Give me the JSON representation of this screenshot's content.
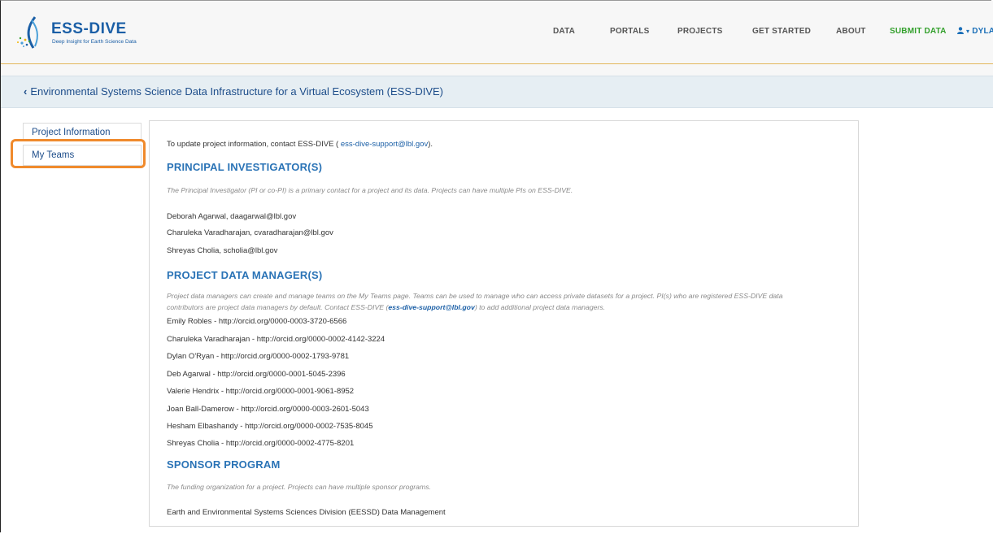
{
  "header": {
    "logo_title": "ESS-DIVE",
    "logo_tagline": "Deep Insight for Earth Science Data",
    "nav": [
      {
        "label": "DATA"
      },
      {
        "label": "PORTALS"
      },
      {
        "label": "PROJECTS"
      },
      {
        "label": "GET STARTED"
      },
      {
        "label": "ABOUT"
      },
      {
        "label": "SUBMIT DATA"
      },
      {
        "label": "DYLAN P."
      }
    ],
    "user_icon": "user-icon",
    "accent_color": "#33a02c",
    "brand_color": "#1b5fa6"
  },
  "breadcrumb": {
    "chevron": "‹",
    "label": "Environmental Systems Science Data Infrastructure for a Virtual Ecosystem (ESS-DIVE)"
  },
  "sidebar": {
    "items": [
      {
        "label": "Project Information"
      },
      {
        "label": "My Teams"
      }
    ],
    "highlight_color": "#f08a2c"
  },
  "main": {
    "intro": {
      "before": "To update project information, contact ESS-DIVE (",
      "link": " ess-dive-support@lbl.gov",
      "after": ")."
    },
    "pi": {
      "heading": "PRINCIPAL INVESTIGATOR(S)",
      "description": "The Principal Investigator (PI or co-PI) is a primary contact for a project and its data. Projects can have multiple PIs on ESS-DIVE.",
      "people": [
        "Deborah Agarwal, daagarwal@lbl.gov",
        "Charuleka Varadharajan, cvaradharajan@lbl.gov",
        "Shreyas Cholia, scholia@lbl.gov"
      ]
    },
    "managers": {
      "heading": "PROJECT DATA MANAGER(S)",
      "description_line1": "Project data managers can create and manage teams on the My Teams page. Teams can be used to manage who can access private datasets for a project. PI(s) who are registered ESS-DIVE data",
      "description_line2_before": "contributors are project data managers by default. Contact ESS-DIVE (",
      "description_link": "ess-dive-support@lbl.gov",
      "description_line2_after": ") to add additional project data managers.",
      "people": [
        "Emily Robles - http://orcid.org/0000-0003-3720-6566",
        "Charuleka Varadharajan - http://orcid.org/0000-0002-4142-3224",
        "Dylan O'Ryan - http://orcid.org/0000-0002-1793-9781",
        "Deb Agarwal - http://orcid.org/0000-0001-5045-2396",
        "Valerie Hendrix - http://orcid.org/0000-0001-9061-8952",
        "Joan Ball-Damerow - http://orcid.org/0000-0003-2601-5043",
        "Hesham Elbashandy - http://orcid.org/0000-0002-7535-8045",
        "Shreyas Cholia - http://orcid.org/0000-0002-4775-8201"
      ]
    },
    "sponsor": {
      "heading": "SPONSOR PROGRAM",
      "description": "The funding organization for a project. Projects can have multiple sponsor programs.",
      "program": "Earth and Environmental Systems Sciences Division (EESSD) Data Management"
    }
  }
}
